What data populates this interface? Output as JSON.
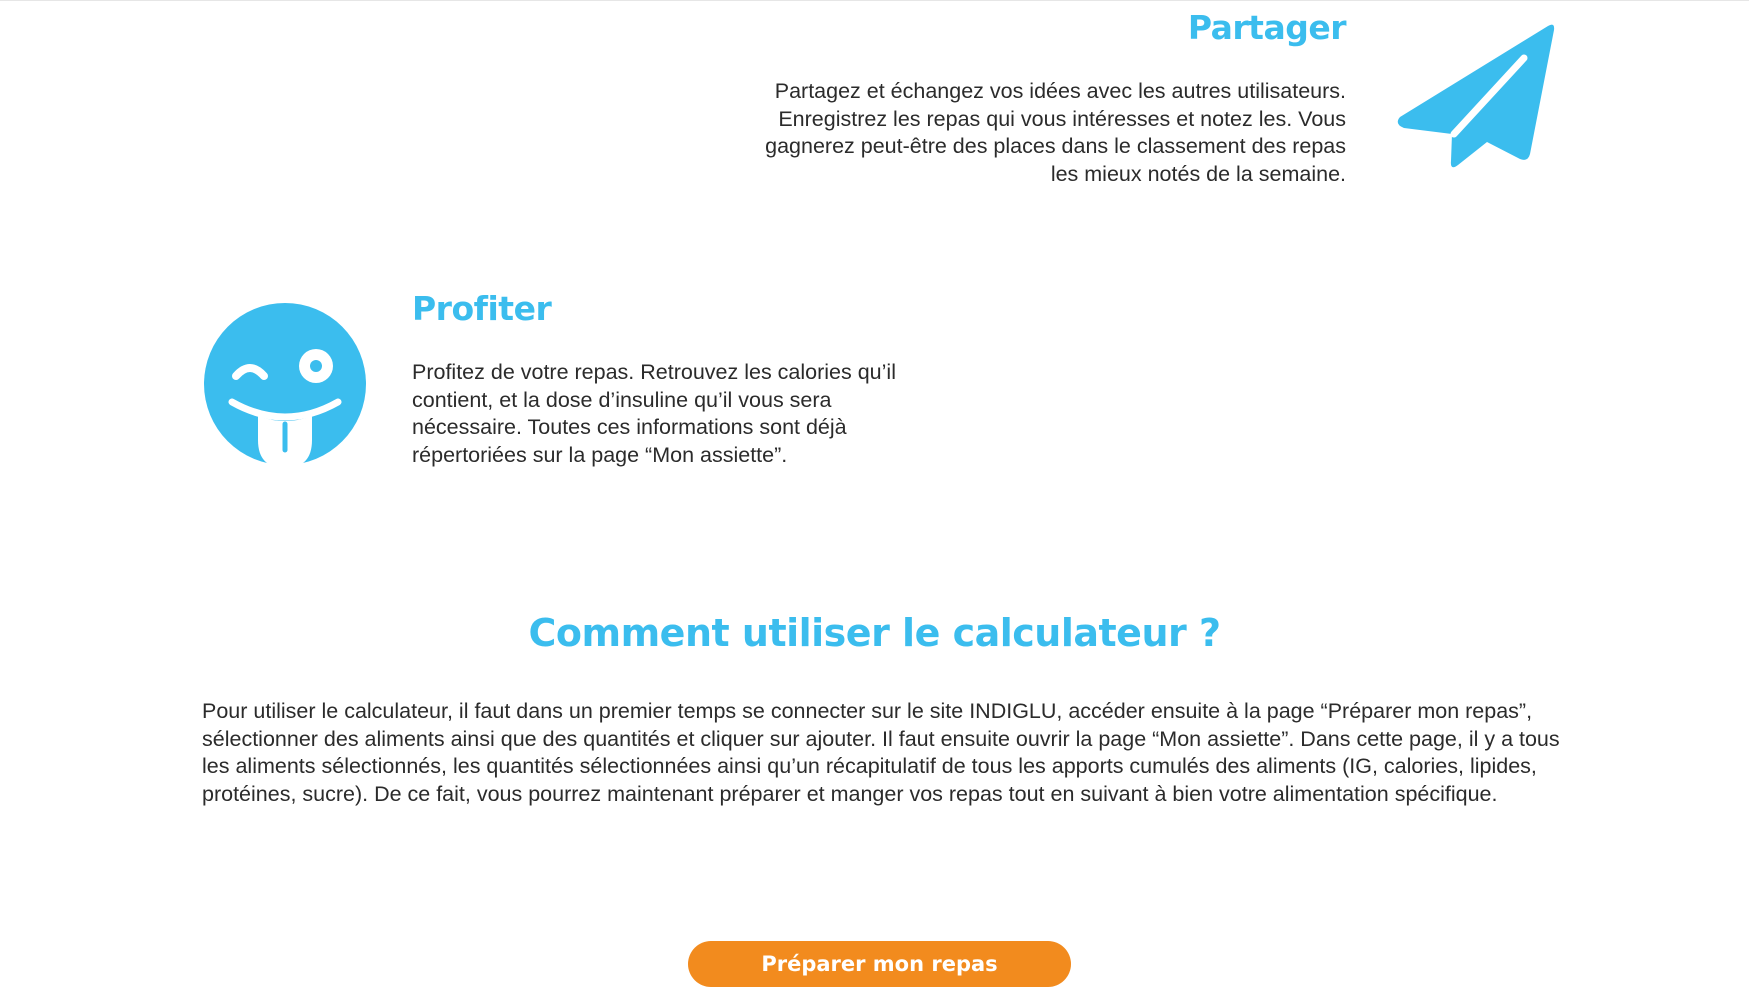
{
  "colors": {
    "accent": "#3BBDEE",
    "button": "#F28B1E",
    "text": "#2B2B2B"
  },
  "partager": {
    "title": "Partager",
    "text": "Partagez et échangez vos idées avec les autres utilisateurs. Enregistrez les repas qui vous intéresses et notez les. Vous gagnerez peut-être des places dans le classement des repas les mieux notés de la semaine.",
    "icon": "paper-plane-icon"
  },
  "profiter": {
    "title": "Profiter",
    "text": "Profitez de votre repas. Retrouvez les calories qu’il contient, et la dose d’insuline qu’il vous sera nécessaire. Toutes ces informations sont déjà répertoriées sur la page “Mon assiette”.",
    "icon": "wink-tongue-emoji-icon"
  },
  "calculator": {
    "title": "Comment utiliser le calculateur ?",
    "text": "Pour utiliser le calculateur, il faut dans un premier temps se connecter sur le site INDIGLU, accéder ensuite à la page “Préparer mon repas”, sélectionner des aliments ainsi que des quantités et cliquer sur ajouter. Il faut ensuite ouvrir la page “Mon assiette”. Dans cette page, il y a tous les aliments sélectionnés, les quantités sélectionnées ainsi qu’un récapitulatif de tous les apports cumulés des aliments (IG, calories, lipides, protéines, sucre). De ce fait, vous pourrez maintenant préparer et manger vos repas tout en suivant à bien votre alimentation spécifique."
  },
  "cta": {
    "label": "Préparer mon repas"
  }
}
